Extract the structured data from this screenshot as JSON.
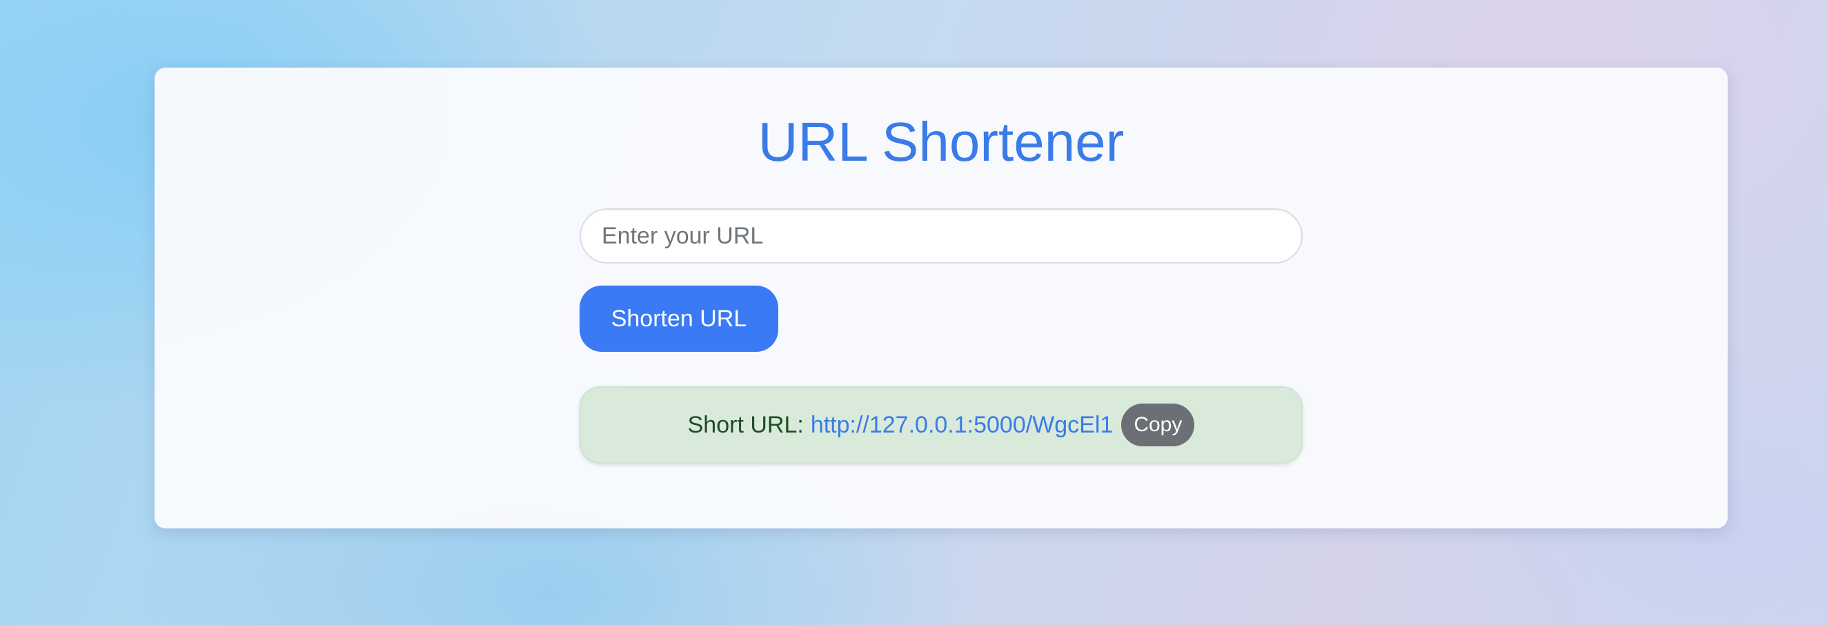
{
  "app": {
    "title": "URL Shortener"
  },
  "form": {
    "url_input": {
      "value": "",
      "placeholder": "Enter your URL"
    },
    "submit_label": "Shorten URL"
  },
  "result": {
    "label": "Short URL:",
    "short_url": "http://127.0.0.1:5000/WgcEl1",
    "copy_label": "Copy"
  },
  "colors": {
    "accent": "#3a7af5",
    "title": "#3a7be8",
    "result_bg": "#d9eadb",
    "result_text": "#1d4d24",
    "copy_button": "#6c7076"
  }
}
